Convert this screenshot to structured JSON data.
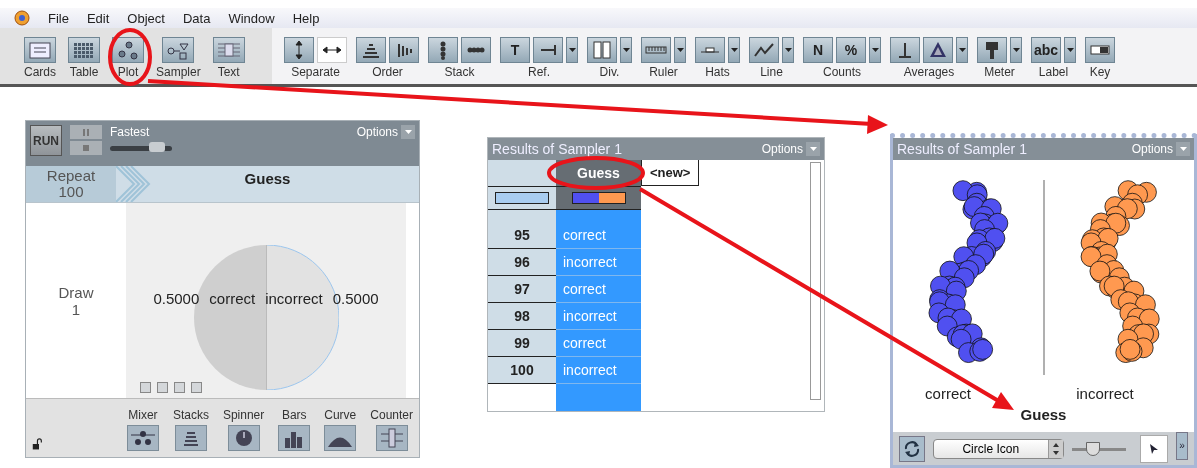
{
  "menu": [
    "File",
    "Edit",
    "Object",
    "Data",
    "Window",
    "Help"
  ],
  "object_tools": [
    {
      "label": "Cards"
    },
    {
      "label": "Table"
    },
    {
      "label": "Plot"
    },
    {
      "label": "Sampler"
    },
    {
      "label": "Text"
    }
  ],
  "plot_tools": [
    {
      "label": "Separate",
      "buttons": [
        {
          "selected": false
        },
        {
          "selected": true
        }
      ],
      "dropdown": false
    },
    {
      "label": "Order",
      "buttons": [
        {
          "selected": false
        },
        {
          "selected": false
        }
      ],
      "dropdown": false
    },
    {
      "label": "Stack",
      "buttons": [
        {
          "selected": false
        },
        {
          "selected": false
        }
      ],
      "dropdown": false
    },
    {
      "label": "Ref.",
      "buttons": [
        {
          "selected": false,
          "glyph": "T"
        },
        {
          "selected": false
        }
      ],
      "dropdown": true
    },
    {
      "label": "Div.",
      "buttons": [
        {
          "selected": false
        }
      ],
      "dropdown": true
    },
    {
      "label": "Ruler",
      "buttons": [
        {
          "selected": false
        }
      ],
      "dropdown": true
    },
    {
      "label": "Hats",
      "buttons": [
        {
          "selected": false
        }
      ],
      "dropdown": true
    },
    {
      "label": "Line",
      "buttons": [
        {
          "selected": false
        }
      ],
      "dropdown": true
    },
    {
      "label": "Counts",
      "buttons": [
        {
          "selected": false,
          "glyph": "N"
        },
        {
          "selected": false,
          "glyph": "%"
        }
      ],
      "dropdown": true
    },
    {
      "label": "Averages",
      "buttons": [
        {
          "selected": false
        },
        {
          "selected": false
        }
      ],
      "dropdown": true
    },
    {
      "label": "Meter",
      "buttons": [
        {
          "selected": false
        }
      ],
      "dropdown": true
    },
    {
      "label": "Label",
      "buttons": [
        {
          "selected": false,
          "glyph": "abc"
        }
      ],
      "dropdown": true
    },
    {
      "label": "Key",
      "buttons": [
        {
          "selected": false
        }
      ],
      "dropdown": false
    }
  ],
  "sampler": {
    "run": "RUN",
    "speed_label": "Fastest",
    "speed": {
      "level": 0.75
    },
    "options": "Options",
    "repeat_label": "Repeat",
    "repeat_value": "100",
    "attribute": "Guess",
    "draw_label": "Draw",
    "draw_value": "1",
    "slices": [
      {
        "value": "0.5000",
        "label": "correct"
      },
      {
        "label": "incorrect",
        "value": "0.5000"
      }
    ],
    "devices": [
      "Mixer",
      "Stacks",
      "Spinner",
      "Bars",
      "Curve",
      "Counter"
    ],
    "locked": false
  },
  "table": {
    "title": "Results of Sampler 1",
    "options": "Options",
    "column": "Guess",
    "new_column": "<new>",
    "rows": [
      {
        "case": "95",
        "guess": "correct"
      },
      {
        "case": "96",
        "guess": "incorrect"
      },
      {
        "case": "97",
        "guess": "correct"
      },
      {
        "case": "98",
        "guess": "incorrect"
      },
      {
        "case": "99",
        "guess": "correct"
      },
      {
        "case": "100",
        "guess": "incorrect"
      }
    ]
  },
  "plot": {
    "title": "Results of Sampler 1",
    "options": "Options",
    "groups": [
      {
        "label": "correct",
        "color": "#5050f0"
      },
      {
        "label": "incorrect",
        "color": "#ff9950"
      }
    ],
    "axis_label": "Guess",
    "icon_menu": "Circle Icon",
    "icon_size": {
      "level": 0.4
    },
    "more_glyph": "»"
  }
}
